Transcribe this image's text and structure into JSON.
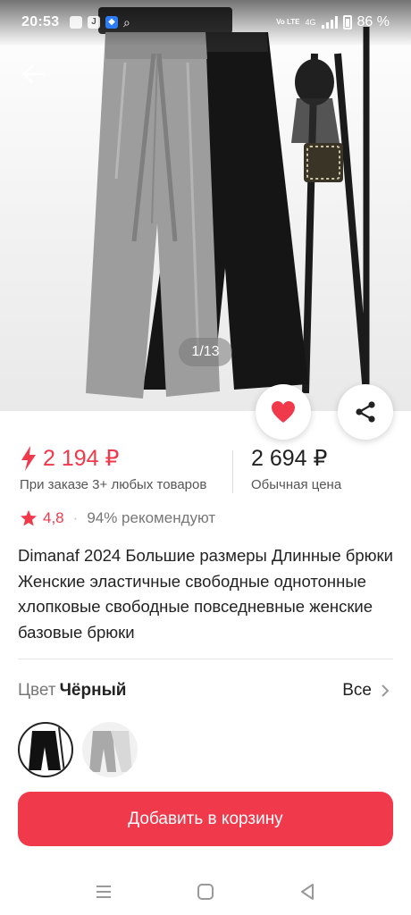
{
  "status_bar": {
    "time": "20:53",
    "battery": "86 %",
    "network_label": "Vo LTE",
    "network_gen": "4G"
  },
  "gallery": {
    "counter": "1/13",
    "current_index": 1,
    "total": 13
  },
  "price": {
    "sale_amount": "2 194 ₽",
    "sale_note": "При заказе 3+ любых товаров",
    "regular_amount": "2 694 ₽",
    "regular_note": "Обычная цена"
  },
  "rating": {
    "score": "4,8",
    "recommend": "94% рекомендуют"
  },
  "product": {
    "title": "Dimanaf 2024 Большие размеры Длинные брюки Женские эластичные свободные однотонные хлопковые свободные повседневные женские базовые брюки"
  },
  "color_selector": {
    "label": "Цвет",
    "selected": "Чёрный",
    "see_all": "Все"
  },
  "actions": {
    "add_to_cart": "Добавить в корзину"
  },
  "icons": {
    "back": "arrow-left-icon",
    "like": "heart-icon",
    "share": "share-icon",
    "lightning": "lightning-icon",
    "star": "star-icon",
    "chevron": "chevron-right-icon",
    "nav_menu": "menu-icon",
    "nav_home": "home-square-icon",
    "nav_back": "triangle-back-icon"
  },
  "colors": {
    "accent": "#f0394b",
    "text": "#222222",
    "muted": "#777777"
  }
}
